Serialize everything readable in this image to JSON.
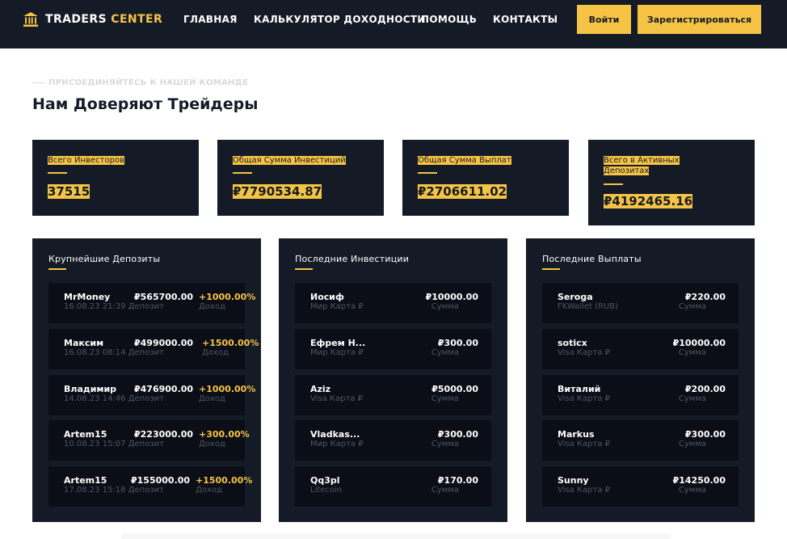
{
  "header": {
    "logo_main": "TRADERS",
    "logo_accent": "CENTER",
    "logo_icon": "bank-icon",
    "nav": [
      "ГЛАВНАЯ",
      "КАЛЬКУЛЯТОР ДОХОДНОСТИ",
      "ПОМОЩЬ",
      "КОНТАКТЫ"
    ],
    "login_label": "Войти",
    "register_label": "Зарегистрироваться"
  },
  "intro": {
    "eyebrow": "ПРИСОЕДИНЯЙТЕСЬ К НАШЕЙ КОМАНДЕ",
    "title": "Нам Доверяют Трейдеры"
  },
  "stats": [
    {
      "label": "Всего Инвесторов",
      "value": "37515"
    },
    {
      "label": "Общая Сумма Инвестиций",
      "value": "₽7790534.87"
    },
    {
      "label": "Общая Сумма Выплат",
      "value": "₽2706611.02"
    },
    {
      "label": "Всего в Активных Депозитах",
      "value": "₽4192465.16"
    }
  ],
  "deposits": {
    "title": "Крупнейшие Депозиты",
    "income_label": "Доход",
    "items": [
      {
        "name": "MrMoney",
        "date": "16.08.23 21:39 Депозит",
        "amount": "₽565700.00",
        "percent": "+1000.00%"
      },
      {
        "name": "Максим",
        "date": "16.08.23 08:14 Депозит",
        "amount": "₽499000.00",
        "percent": "+1500.00%"
      },
      {
        "name": "Владимир",
        "date": "14.08.23 14:46 Депозит",
        "amount": "₽476900.00",
        "percent": "+1000.00%"
      },
      {
        "name": "Artem15",
        "date": "10.08.23 15:07 Депозит",
        "amount": "₽223000.00",
        "percent": "+300.00%"
      },
      {
        "name": "Artem15",
        "date": "17.08.23 15:18 Депозит",
        "amount": "₽155000.00",
        "percent": "+1500.00%"
      }
    ]
  },
  "investments": {
    "title": "Последние Инвестиции",
    "sum_label": "Сумма",
    "items": [
      {
        "name": "Иосиф",
        "method": "Мир Карта ₽",
        "amount": "₽10000.00"
      },
      {
        "name": "Ефрем Н...",
        "method": "Мир Карта ₽",
        "amount": "₽300.00"
      },
      {
        "name": "Aziz",
        "method": "Visa Карта ₽",
        "amount": "₽5000.00"
      },
      {
        "name": "Vladkas...",
        "method": "Мир Карта ₽",
        "amount": "₽300.00"
      },
      {
        "name": "Qq3pl",
        "method": "Litecoin",
        "amount": "₽170.00"
      }
    ]
  },
  "payouts": {
    "title": "Последние Выплаты",
    "sum_label": "Сумма",
    "items": [
      {
        "name": "Seroga",
        "method": "FKWallet (RUB)",
        "amount": "₽220.00"
      },
      {
        "name": "soticx",
        "method": "Visa Карта ₽",
        "amount": "₽10000.00"
      },
      {
        "name": "Виталий",
        "method": "Visa Карта ₽",
        "amount": "₽200.00"
      },
      {
        "name": "Markus",
        "method": "Visa Карта ₽",
        "amount": "₽300.00"
      },
      {
        "name": "Sunny",
        "method": "Visa Карта ₽",
        "amount": "₽14250.00"
      }
    ]
  },
  "colors": {
    "accent": "#f5c445",
    "dark": "#151a27",
    "row": "#0b0e16"
  }
}
